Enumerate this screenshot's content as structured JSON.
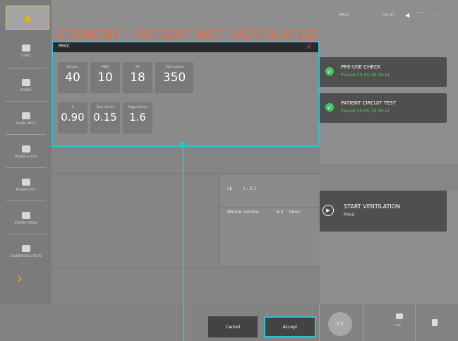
{
  "status": {
    "mode": "PRVC",
    "time": "09:37",
    "ind1": "-----",
    "ind2": "- - -"
  },
  "main": {
    "title": "STANDBY - PATIENT NOT VENTILATED"
  },
  "sidebar": {
    "top_icon": "alarm-bell-icon",
    "items": [
      {
        "label": "ICONS",
        "icon": "settings-icon"
      },
      {
        "label": "PATIENT",
        "icon": "patient-icon"
      },
      {
        "label": "ALARM LIMITS",
        "icon": "alarm-limits-icon"
      },
      {
        "label": "TRENDS & LOGS",
        "icon": "trends-icon"
      },
      {
        "label": "PATIENT DATA",
        "icon": "patient-data-icon"
      },
      {
        "label": "SYSTEM STATUS",
        "icon": "system-status-icon"
      },
      {
        "label": "CALIBRATION & TESTS",
        "icon": "calibration-icon"
      }
    ]
  },
  "popup": {
    "title": "PRVC",
    "close": "✕",
    "params": [
      {
        "label": "O2 conc.",
        "value": "40"
      },
      {
        "label": "PEEP",
        "value": "10"
      },
      {
        "label": "RR",
        "value": "18"
      },
      {
        "label": "Tidal volume",
        "value": "350"
      },
      {
        "label": "Ti",
        "value": "0.90"
      },
      {
        "label": "Trise rise (s)",
        "value": "0.15"
      },
      {
        "label": "Trigger (l/min)",
        "value": "1.6"
      }
    ]
  },
  "ratio": {
    "ie_label": "I:E",
    "ie_value": "1 : 2.7",
    "mv_label": "Minute volume",
    "mv_value": "6.3",
    "mv_unit": "l/min"
  },
  "checks": [
    {
      "title": "PRE-USE CHECK",
      "sub": "Passed 20-05-18 09:14"
    },
    {
      "title": "PATIENT CIRCUIT TEST",
      "sub": "Passed 20-05-18 09:14"
    }
  ],
  "start": {
    "title": "START VENTILATION",
    "sub": "PRVC"
  },
  "buttons": {
    "cancel": "Cancel",
    "accept": "Accept"
  },
  "bottom": {
    "circle": "CS",
    "item2": "Lock",
    "item3": ""
  },
  "colors": {
    "accent": "#28c2d2",
    "title": "#e46a46",
    "pass": "#51cf59",
    "alarm": "#e3b300"
  }
}
